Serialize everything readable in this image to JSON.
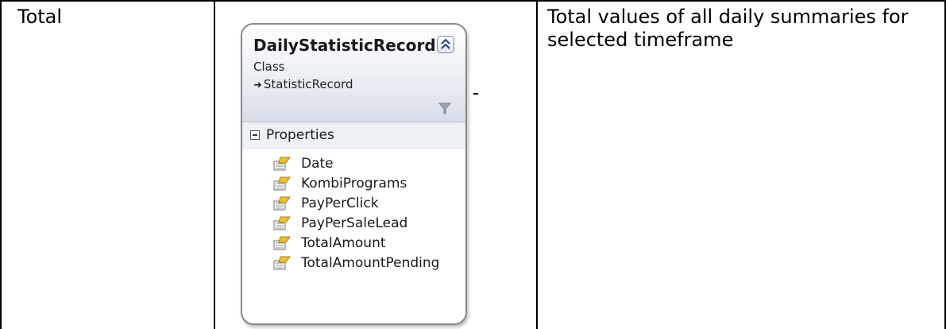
{
  "table": {
    "row_label": "Total",
    "description": "Total values of all daily summaries for selected timeframe"
  },
  "class_shape": {
    "name": "DailyStatisticRecord",
    "kind": "Class",
    "base_class": "StatisticRecord",
    "section_title": "Properties",
    "properties": [
      "Date",
      "KombiPrograms",
      "PayPerClick",
      "PayPerSaleLead",
      "TotalAmount",
      "TotalAmountPending"
    ]
  },
  "icons": {
    "collapse": "collapse-chevrons-icon",
    "filter": "filter-icon",
    "inheritance": "inheritance-arrow-icon",
    "property": "property-icon"
  },
  "colors": {
    "header_gradient_end": "#d7dde8",
    "border": "#8a8a8a",
    "section_bg": "#eef1f5"
  }
}
